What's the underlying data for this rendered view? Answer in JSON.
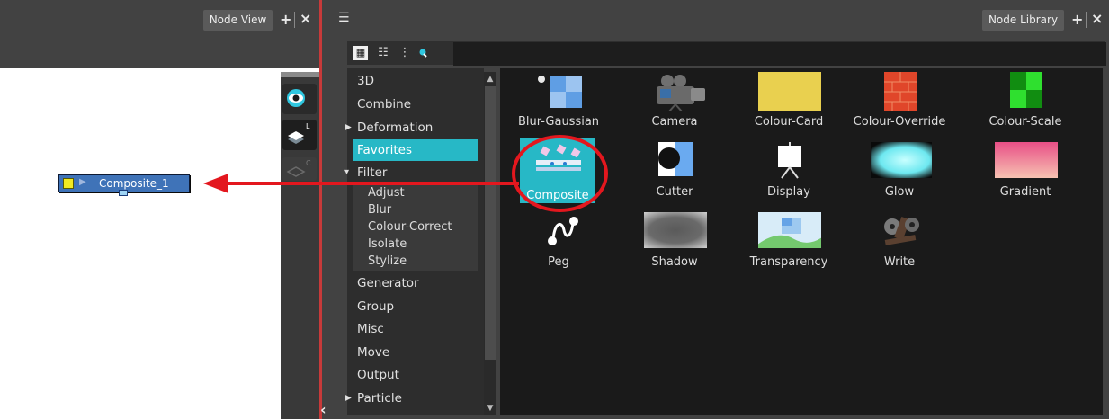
{
  "node_view": {
    "tab_label": "Node View",
    "add_label": "+",
    "close_label": "×",
    "node": {
      "label": "Composite_1"
    }
  },
  "node_library": {
    "tab_label": "Node Library",
    "add_label": "+",
    "close_label": "×",
    "menu_icon": "hamburger-icon",
    "search_placeholder": "",
    "categories": [
      {
        "label": "3D",
        "expandable": false
      },
      {
        "label": "Combine",
        "expandable": false
      },
      {
        "label": "Deformation",
        "expandable": true,
        "expanded": false
      },
      {
        "label": "Favorites",
        "expandable": false,
        "selected": true
      },
      {
        "label": "Filter",
        "expandable": true,
        "expanded": true
      },
      {
        "label": "Generator",
        "expandable": false
      },
      {
        "label": "Group",
        "expandable": false
      },
      {
        "label": "Misc",
        "expandable": false
      },
      {
        "label": "Move",
        "expandable": false
      },
      {
        "label": "Output",
        "expandable": false
      },
      {
        "label": "Particle",
        "expandable": true,
        "expanded": false
      }
    ],
    "filter_subcategories": [
      "Adjust",
      "Blur",
      "Colour-Correct",
      "Isolate",
      "Stylize"
    ],
    "tiles": [
      {
        "label": "Blur-Gaussian",
        "icon": "blur-gaussian-icon"
      },
      {
        "label": "Camera",
        "icon": "camera-icon"
      },
      {
        "label": "Colour-Card",
        "icon": "colour-card-icon"
      },
      {
        "label": "Colour-Override",
        "icon": "colour-override-icon"
      },
      {
        "label": "Colour-Scale",
        "icon": "colour-scale-icon"
      },
      {
        "label": "Composite",
        "icon": "composite-icon",
        "selected": true
      },
      {
        "label": "Cutter",
        "icon": "cutter-icon"
      },
      {
        "label": "Display",
        "icon": "display-icon"
      },
      {
        "label": "Glow",
        "icon": "glow-icon"
      },
      {
        "label": "Gradient",
        "icon": "gradient-icon"
      },
      {
        "label": "Peg",
        "icon": "peg-icon"
      },
      {
        "label": "Shadow",
        "icon": "shadow-icon"
      },
      {
        "label": "Transparency",
        "icon": "transparency-icon"
      },
      {
        "label": "Write",
        "icon": "write-icon"
      }
    ]
  },
  "colors": {
    "selection": "#27b8c6",
    "annotation": "#e3171e",
    "node_fill": "#3f73b8"
  }
}
